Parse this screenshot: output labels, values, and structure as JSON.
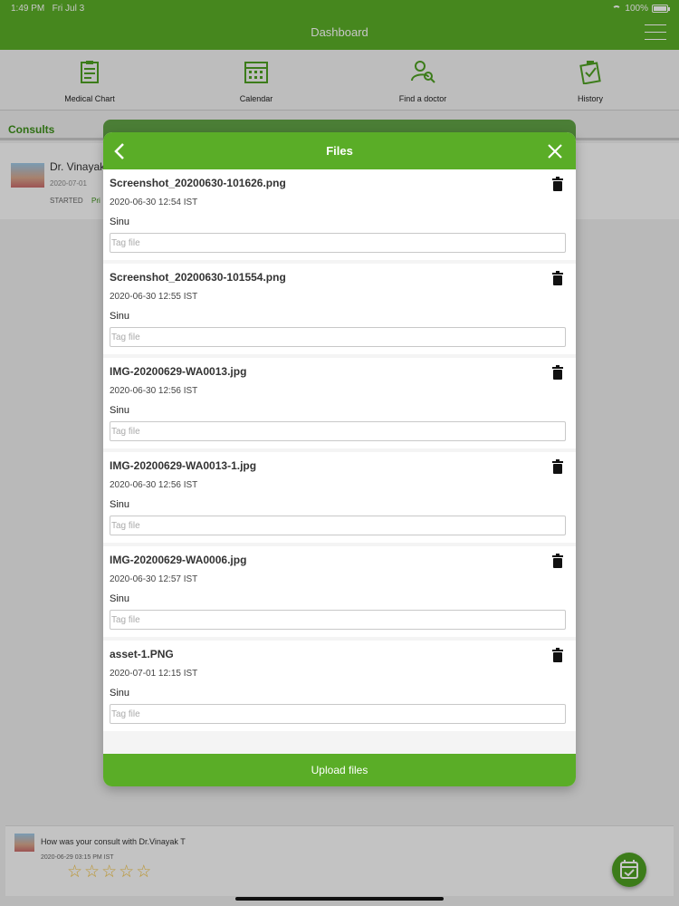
{
  "status_bar": {
    "time": "1:49 PM",
    "date": "Fri Jul 3",
    "battery": "100%"
  },
  "app": {
    "title": "Dashboard"
  },
  "topnav": [
    {
      "label": "Medical Chart",
      "icon": "clipboard-icon"
    },
    {
      "label": "Calendar",
      "icon": "calendar-icon"
    },
    {
      "label": "Find a doctor",
      "icon": "find-doctor-icon"
    },
    {
      "label": "History",
      "icon": "history-icon"
    }
  ],
  "consults": {
    "title": "Consults",
    "item": {
      "name": "Dr. Vinayak",
      "date": "2020-07-01",
      "status": "STARTED",
      "sub": "Pri"
    }
  },
  "modal": {
    "title": "Files",
    "upload_label": "Upload files",
    "files": [
      {
        "name": "Screenshot_20200630-101626.png",
        "date": "2020-06-30 12:54 IST",
        "owner": "Sinu",
        "tag_placeholder": "Tag file"
      },
      {
        "name": "Screenshot_20200630-101554.png",
        "date": "2020-06-30 12:55 IST",
        "owner": "Sinu",
        "tag_placeholder": "Tag file"
      },
      {
        "name": "IMG-20200629-WA0013.jpg",
        "date": "2020-06-30 12:56 IST",
        "owner": "Sinu",
        "tag_placeholder": "Tag file"
      },
      {
        "name": "IMG-20200629-WA0013-1.jpg",
        "date": "2020-06-30 12:56 IST",
        "owner": "Sinu",
        "tag_placeholder": "Tag file"
      },
      {
        "name": "IMG-20200629-WA0006.jpg",
        "date": "2020-06-30 12:57 IST",
        "owner": "Sinu",
        "tag_placeholder": "Tag file"
      },
      {
        "name": "asset-1.PNG",
        "date": "2020-07-01 12:15 IST",
        "owner": "Sinu",
        "tag_placeholder": "Tag file"
      }
    ]
  },
  "feedback": {
    "question": "How was your consult with Dr.Vinayak T",
    "date": "2020-06-29 03:15 PM IST",
    "rating": 0,
    "max_rating": 5
  },
  "colors": {
    "primary_green": "#5aad27",
    "dark_green": "#3d8f1a"
  }
}
